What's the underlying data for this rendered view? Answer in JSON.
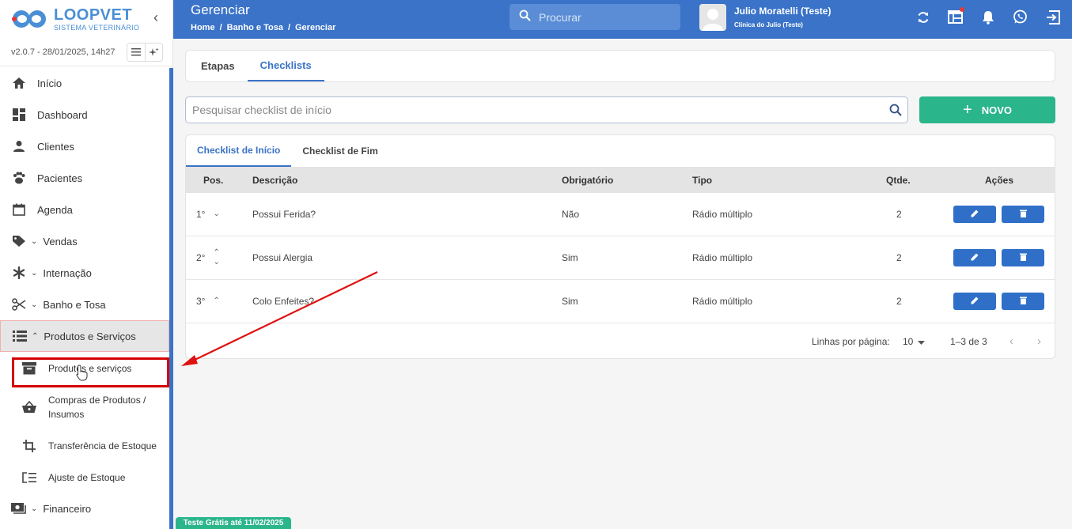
{
  "brand": {
    "name": "LOOPVET",
    "tagline": "SISTEMA VETERINÁRIO",
    "version": "v2.0.7 - 28/01/2025, 14h27"
  },
  "sidebar": {
    "items": [
      {
        "label": "Início",
        "icon": "home-icon"
      },
      {
        "label": "Dashboard",
        "icon": "dashboard-icon"
      },
      {
        "label": "Clientes",
        "icon": "person-icon"
      },
      {
        "label": "Pacientes",
        "icon": "paw-icon"
      },
      {
        "label": "Agenda",
        "icon": "calendar-icon"
      },
      {
        "label": "Vendas",
        "icon": "tag-icon"
      },
      {
        "label": "Internação",
        "icon": "asterisk-icon"
      },
      {
        "label": "Banho e Tosa",
        "icon": "scissors-icon"
      },
      {
        "label": "Produtos e Serviços",
        "icon": "list-icon"
      }
    ],
    "subitems": [
      {
        "label": "Produtos e serviços",
        "icon": "archive-box-icon"
      },
      {
        "label": "Compras de Produtos / Insumos",
        "icon": "basket-icon"
      },
      {
        "label": "Transferência de Estoque",
        "icon": "crop-icon"
      },
      {
        "label": "Ajuste de Estoque",
        "icon": "list-adjust-icon"
      }
    ],
    "financeiro": {
      "label": "Financeiro",
      "icon": "cash-icon"
    }
  },
  "header": {
    "title": "Gerenciar",
    "breadcrumb": [
      "Home",
      "Banho e Tosa",
      "Gerenciar"
    ],
    "search_placeholder": "Procurar",
    "user_name": "Julio Moratelli (Teste)",
    "user_clinic": "Clínica do Julio (Teste)"
  },
  "main": {
    "tabs": [
      {
        "label": "Etapas"
      },
      {
        "label": "Checklists"
      }
    ],
    "search_placeholder": "Pesquisar checklist de início",
    "new_button": "NOVO",
    "subtabs": [
      {
        "label": "Checklist de Início"
      },
      {
        "label": "Checklist de Fim"
      }
    ],
    "columns": {
      "pos": "Pos.",
      "desc": "Descrição",
      "obr": "Obrigatório",
      "tipo": "Tipo",
      "qtde": "Qtde.",
      "acoes": "Ações"
    },
    "rows": [
      {
        "pos": "1°",
        "desc": "Possui Ferida?",
        "obr": "Não",
        "tipo": "Rádio múltiplo",
        "qtde": "2"
      },
      {
        "pos": "2°",
        "desc": "Possui Alergia",
        "obr": "Sim",
        "tipo": "Rádio múltiplo",
        "qtde": "2"
      },
      {
        "pos": "3°",
        "desc": "Colo Enfeites?",
        "obr": "Sim",
        "tipo": "Rádio múltiplo",
        "qtde": "2"
      }
    ],
    "pagination": {
      "label": "Linhas por página:",
      "per_page": "10",
      "range": "1–3 de 3"
    }
  },
  "trial": "Teste Grátis até 11/02/2025",
  "colors": {
    "primary": "#3a73c8",
    "accent": "#2bb58a",
    "highlight": "#d40000"
  }
}
